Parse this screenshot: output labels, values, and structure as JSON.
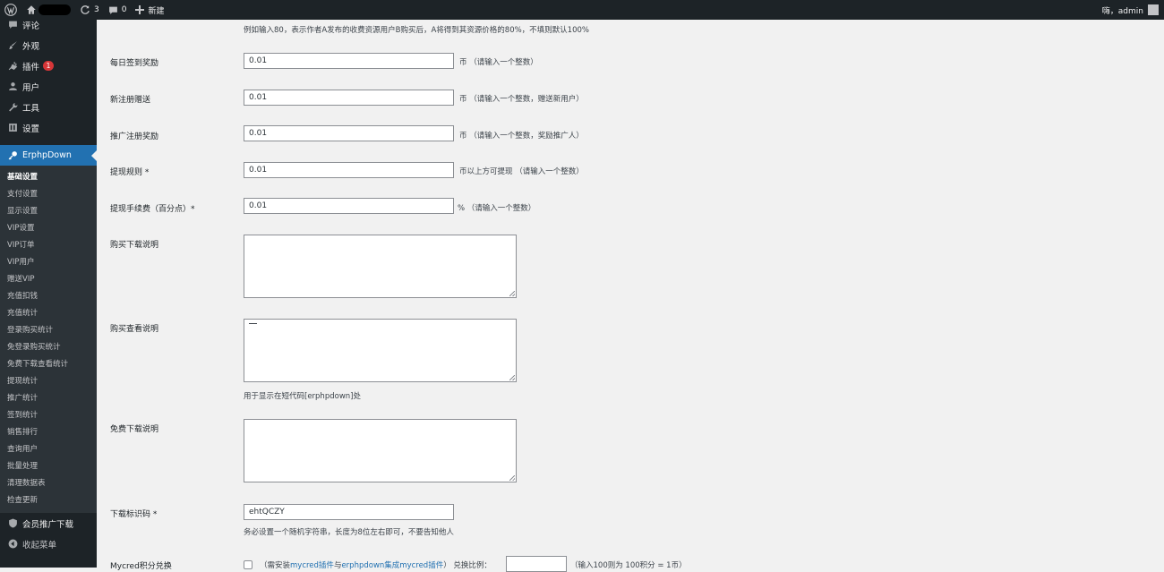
{
  "adminbar": {
    "updates_count": "3",
    "comments_count": "0",
    "new_label": "新建",
    "greeting": "嗨，admin"
  },
  "sidebar": {
    "top_items": [
      {
        "label": "评论",
        "icon": "comment-icon"
      },
      {
        "label": "外观",
        "icon": "paintbrush-icon"
      },
      {
        "label": "插件",
        "icon": "plugin-icon",
        "badge": "1"
      },
      {
        "label": "用户",
        "icon": "user-icon"
      },
      {
        "label": "工具",
        "icon": "wrench-icon"
      },
      {
        "label": "设置",
        "icon": "settings-icon"
      }
    ],
    "active": {
      "label": "ErphpDown",
      "icon": "key-icon"
    },
    "submenu": [
      "基础设置",
      "支付设置",
      "显示设置",
      "VIP设置",
      "VIP订单",
      "VIP用户",
      "赠送VIP",
      "充值扣钱",
      "充值统计",
      "登录购买统计",
      "免登录购买统计",
      "免费下载查看统计",
      "提现统计",
      "推广统计",
      "签到统计",
      "销售排行",
      "查询用户",
      "批量处理",
      "清理数据表",
      "检查更新"
    ],
    "bottom_items": [
      {
        "label": "会员推广下载",
        "icon": "shield-icon"
      },
      {
        "label": "收起菜单",
        "icon": "collapse-icon"
      }
    ]
  },
  "form": {
    "top_desc": "例如输入80，表示作者A发布的收费资源用户B购买后，A将得到其资源价格的80%，不填则默认100%",
    "rows": [
      {
        "label": "每日签到奖励",
        "value": "0.01",
        "hint": "币 （请输入一个整数）"
      },
      {
        "label": "新注册赠送",
        "value": "0.01",
        "hint": "币 （请输入一个整数，赠送新用户）"
      },
      {
        "label": "推广注册奖励",
        "value": "0.01",
        "hint": "币 （请输入一个整数，奖励推广人）"
      },
      {
        "label": "提现规则 *",
        "value": "0.01",
        "hint": "币以上方可提现 （请输入一个整数）"
      },
      {
        "label": "提现手续费（百分点）*",
        "value": "0.01",
        "hint": "% （请输入一个整数）"
      }
    ],
    "buy_download_label": "购买下载说明",
    "buy_view_label": "购买查看说明",
    "buy_view_desc": "用于显示在短代码[erphpdown]处",
    "free_download_label": "免费下载说明",
    "download_code_label": "下载标识码 *",
    "download_code_value": "ehtQCZY",
    "download_code_desc": "务必设置一个随机字符串，长度为8位左右即可，不要告知他人",
    "mycred": {
      "label": "Mycred积分兑换",
      "pre": "（需安装",
      "link1": "mycred插件",
      "mid": "与",
      "link2": "erphpdown集成mycred插件",
      "post": "）  兑换比例：",
      "example": "（输入100则为 100积分 = 1币）"
    }
  }
}
